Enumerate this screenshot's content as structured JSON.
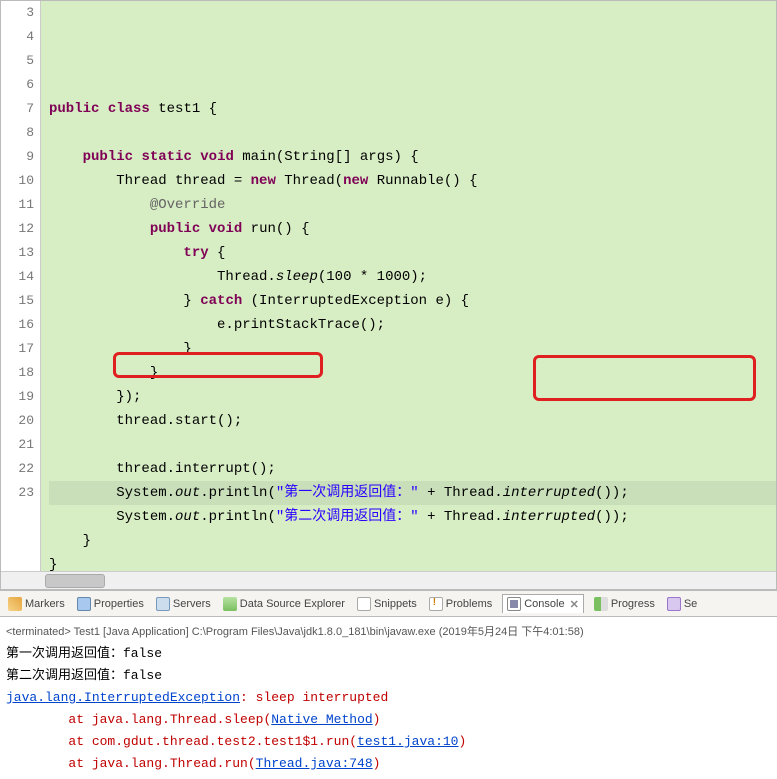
{
  "code": {
    "lines": [
      {
        "n": 3,
        "t": "<span class='kw'>public</span> <span class='kw'>class</span> test1 {"
      },
      {
        "n": 4,
        "t": ""
      },
      {
        "n": 5,
        "t": "    <span class='kw'>public</span> <span class='kw'>static</span> <span class='kw'>void</span> main(String[] args) {"
      },
      {
        "n": 6,
        "t": "        Thread thread = <span class='kw'>new</span> Thread(<span class='kw'>new</span> Runnable() {"
      },
      {
        "n": 7,
        "t": "            <span class='ann'>@Override</span>"
      },
      {
        "n": 8,
        "t": "            <span class='kw'>public</span> <span class='kw'>void</span> run() {"
      },
      {
        "n": 9,
        "t": "                <span class='kw'>try</span> {"
      },
      {
        "n": 10,
        "t": "                    Thread.<span class='static-it'>sleep</span>(100 * 1000);"
      },
      {
        "n": 11,
        "t": "                } <span class='kw'>catch</span> (InterruptedException e) {"
      },
      {
        "n": 12,
        "t": "                    e.printStackTrace();"
      },
      {
        "n": 13,
        "t": "                }"
      },
      {
        "n": 14,
        "t": "            }"
      },
      {
        "n": 15,
        "t": "        });"
      },
      {
        "n": 16,
        "t": "        thread.start();"
      },
      {
        "n": 17,
        "t": ""
      },
      {
        "n": 18,
        "t": "        thread.interrupt();"
      },
      {
        "n": 19,
        "t": "        System.<span class='static-it'>out</span>.println(<span class='str'>\"第一次调用返回值：\"</span> + Thread.<span class='static-it'>interrupted</span>());",
        "hl": true
      },
      {
        "n": 20,
        "t": "        System.<span class='static-it'>out</span>.println(<span class='str'>\"第二次调用返回值：\"</span> + Thread.<span class='static-it'>interrupted</span>());"
      },
      {
        "n": 21,
        "t": "    }"
      },
      {
        "n": 22,
        "t": "}"
      },
      {
        "n": 23,
        "t": ""
      }
    ]
  },
  "tabs": {
    "markers": "Markers",
    "properties": "Properties",
    "servers": "Servers",
    "dataSource": "Data Source Explorer",
    "snippets": "Snippets",
    "problems": "Problems",
    "console": "Console",
    "progress": "Progress",
    "se": "Se"
  },
  "console": {
    "header": "<terminated> Test1 [Java Application] C:\\Program Files\\Java\\jdk1.8.0_181\\bin\\javaw.exe (2019年5月24日 下午4:01:58)",
    "line1": "第一次调用返回值：false",
    "line2": "第二次调用返回值：false",
    "exception": "java.lang.InterruptedException",
    "excMsg": ": sleep interrupted",
    "at1_pre": "        at java.lang.Thread.sleep(",
    "at1_link": "Native Method",
    "at1_post": ")",
    "at2_pre": "        at com.gdut.thread.test2.test1$1.run(",
    "at2_link": "test1.java:10",
    "at2_post": ")",
    "at3_pre": "        at java.lang.Thread.run(",
    "at3_link": "Thread.java:748",
    "at3_post": ")"
  }
}
